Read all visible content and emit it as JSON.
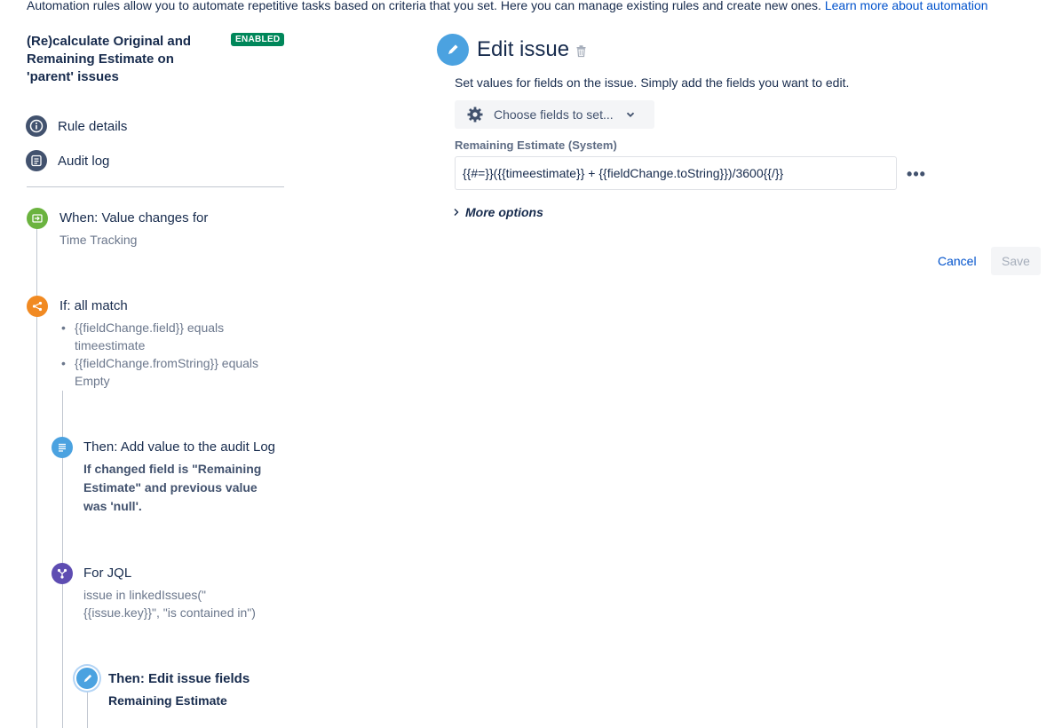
{
  "intro": {
    "text": "Automation rules allow you to automate repetitive tasks based on criteria that you set. Here you can manage existing rules and create new ones. ",
    "link": "Learn more about automation"
  },
  "rule": {
    "title": "(Re)calculate Original and Remaining Estimate on 'parent' issues",
    "status": "ENABLED"
  },
  "nav": {
    "rule_details": "Rule details",
    "audit_log": "Audit log"
  },
  "components": {
    "trigger": {
      "title": "When: Value changes for",
      "sub": "Time Tracking",
      "icon": "trigger-icon",
      "color": "#6bb33f"
    },
    "condition": {
      "title": "If: all match",
      "items": [
        "{{fieldChange.field}} equals timeestimate",
        "{{fieldChange.fromString}} equals Empty"
      ],
      "icon": "branch-icon",
      "color": "#f18a22"
    },
    "audit_action": {
      "title": "Then: Add value to the audit Log",
      "detail": "If changed field is \"Remaining Estimate\" and previous value was 'null'.",
      "icon": "log-icon",
      "color": "#4ba2e0"
    },
    "for_jql": {
      "title": "For JQL",
      "sub": "issue in linkedIssues(\" {{issue.key}}\", \"is contained in\")",
      "icon": "branch-icon",
      "color": "#5e4db2"
    },
    "edit_action": {
      "title": "Then: Edit issue fields",
      "detail": "Remaining Estimate",
      "icon": "pencil-icon",
      "color": "#4ba2e0"
    }
  },
  "editor": {
    "title": "Edit issue",
    "help": "Set values for fields on the issue. Simply add the fields you want to edit.",
    "choose_fields": "Choose fields to set...",
    "field_label": "Remaining Estimate (System)",
    "field_value": "{{#=}}({{timeestimate}} + {{fieldChange.toString}})/3600{{/}}",
    "more_options": "More options",
    "cancel": "Cancel",
    "save": "Save"
  }
}
